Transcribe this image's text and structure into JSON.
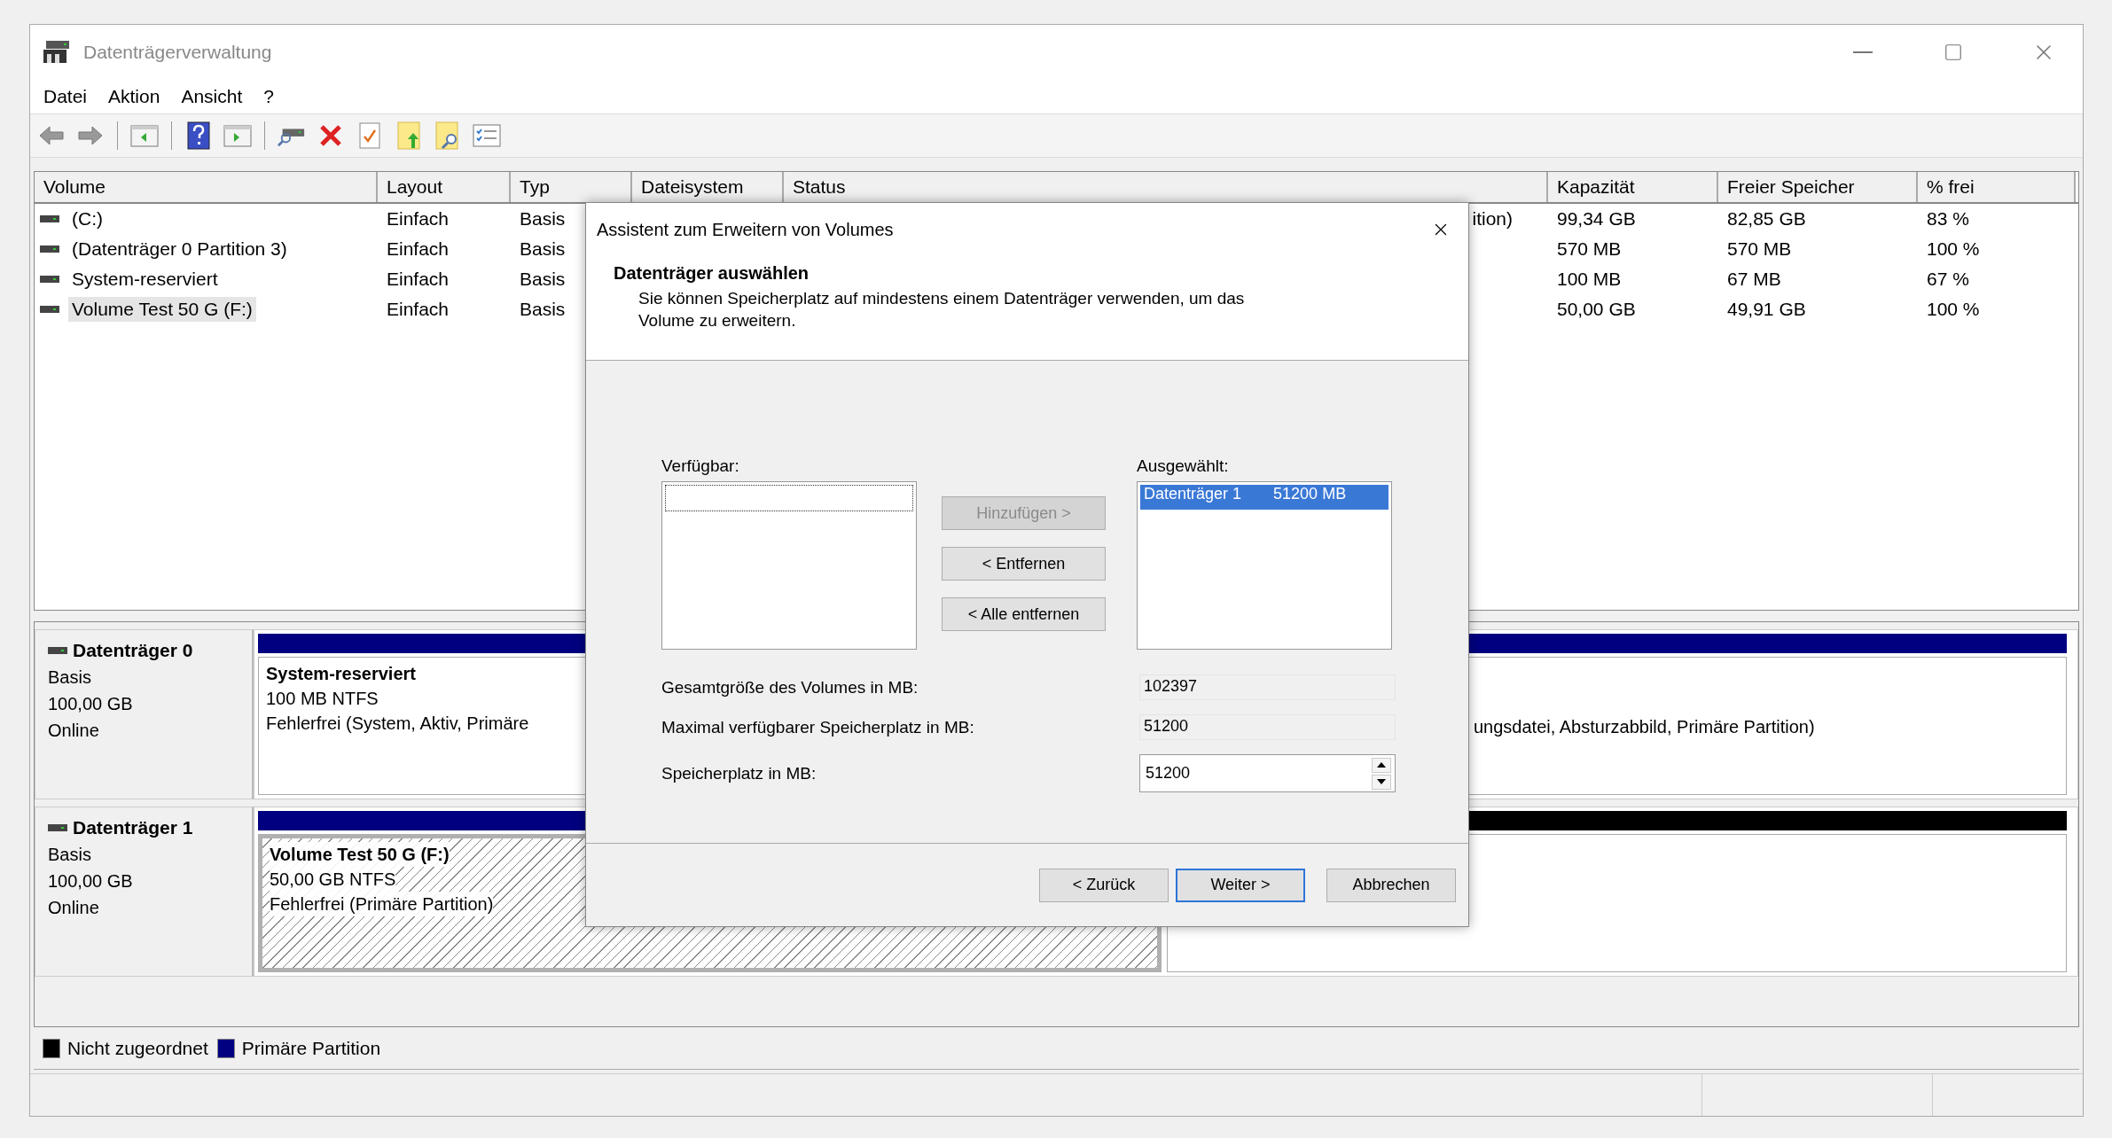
{
  "window": {
    "title": "Datenträgerverwaltung"
  },
  "menu": [
    "Datei",
    "Aktion",
    "Ansicht",
    "?"
  ],
  "volume_table": {
    "columns": [
      "Volume",
      "Layout",
      "Typ",
      "Dateisystem",
      "Status",
      "Kapazität",
      "Freier Speicher",
      "% frei"
    ],
    "rows": [
      {
        "volume": "(C:)",
        "layout": "Einfach",
        "type": "Basis",
        "status": "ition)",
        "capacity": "99,34 GB",
        "free": "82,85 GB",
        "percent_free": "83 %",
        "selected": false
      },
      {
        "volume": "(Datenträger 0 Partition 3)",
        "layout": "Einfach",
        "type": "Basis",
        "capacity": "570 MB",
        "free": "570 MB",
        "percent_free": "100 %",
        "selected": false
      },
      {
        "volume": "System-reserviert",
        "layout": "Einfach",
        "type": "Basis",
        "capacity": "100 MB",
        "free": "67 MB",
        "percent_free": "67 %",
        "selected": false
      },
      {
        "volume": "Volume Test 50 G (F:)",
        "layout": "Einfach",
        "type": "Basis",
        "capacity": "50,00 GB",
        "free": "49,91 GB",
        "percent_free": "100 %",
        "selected": true
      }
    ]
  },
  "disks": [
    {
      "name": "Datenträger 0",
      "type": "Basis",
      "size": "100,00 GB",
      "state": "Online",
      "partitions": [
        {
          "kind": "primary",
          "selected": false,
          "title": "System-reserviert",
          "size": "100 MB NTFS",
          "status": "Fehlerfrei (System, Aktiv, Primäre"
        },
        {
          "kind": "primary",
          "selected": false,
          "status": "ungsdatei, Absturzabbild, Primäre Partition)"
        }
      ]
    },
    {
      "name": "Datenträger 1",
      "type": "Basis",
      "size": "100,00 GB",
      "state": "Online",
      "partitions": [
        {
          "kind": "primary",
          "selected": true,
          "title": "Volume Test 50 G  (F:)",
          "size": "50,00 GB NTFS",
          "status": "Fehlerfrei (Primäre Partition)"
        },
        {
          "kind": "unallocated",
          "selected": false
        }
      ]
    }
  ],
  "legend": [
    {
      "label": "Nicht zugeordnet",
      "color": "#000000"
    },
    {
      "label": "Primäre Partition",
      "color": "#000080"
    }
  ],
  "dialog": {
    "title": "Assistent zum Erweitern von Volumes",
    "heading": "Datenträger auswählen",
    "description": "Sie können Speicherplatz auf mindestens einem Datenträger verwenden, um das Volume zu erweitern.",
    "available": {
      "label": "Verfügbar:"
    },
    "move_buttons": [
      {
        "label": "Hinzufügen >",
        "disabled": true
      },
      {
        "label": "< Entfernen",
        "disabled": false
      },
      {
        "label": "< Alle entfernen",
        "disabled": false
      }
    ],
    "selected_list": {
      "label": "Ausgewählt:",
      "items": [
        {
          "disk": "Datenträger 1",
          "size": "51200 MB",
          "selected": true
        }
      ]
    },
    "fields": [
      {
        "label": "Gesamtgröße des Volumes in MB:",
        "value": "102397",
        "kind": "readonly"
      },
      {
        "label": "Maximal verfügbarer Speicherplatz in MB:",
        "value": "51200",
        "kind": "readonly"
      },
      {
        "label": "Speicherplatz in MB:",
        "value": "51200",
        "kind": "spin"
      }
    ],
    "buttons": [
      {
        "label": "< Zurück",
        "default": false
      },
      {
        "label": "Weiter >",
        "default": true
      },
      {
        "label": "Abbrechen",
        "default": false
      }
    ]
  }
}
